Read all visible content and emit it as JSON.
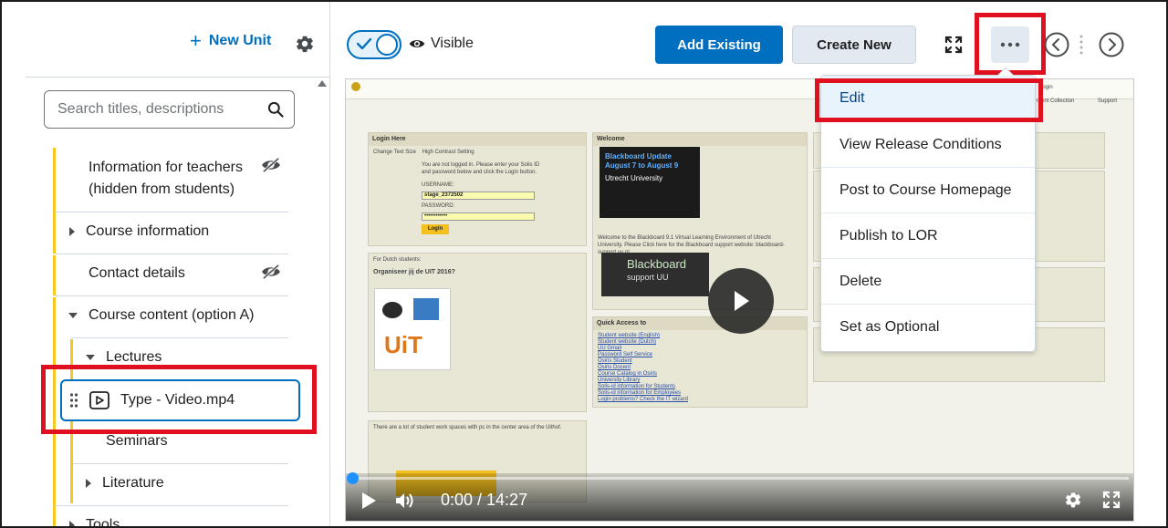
{
  "left_panel": {
    "new_unit_label": "New Unit",
    "search_placeholder": "Search titles, descriptions",
    "tree": [
      {
        "label": "Information for teachers (hidden from students)",
        "hidden": true
      },
      {
        "label": "Course information",
        "expanded": false
      },
      {
        "label": "Contact details",
        "hidden": true
      },
      {
        "label": "Course content (option A)",
        "expanded": true
      },
      {
        "label": "Lectures",
        "expanded": true
      },
      {
        "label": "Type - Video.mp4",
        "selected": true
      },
      {
        "label": "Seminars"
      },
      {
        "label": "Literature",
        "expanded": false
      },
      {
        "label": "Tools",
        "expanded": false
      }
    ]
  },
  "toolbar": {
    "visibility_label": "Visible",
    "visibility_on": true,
    "add_existing_label": "Add Existing",
    "create_new_label": "Create New"
  },
  "menu": {
    "items": [
      "Edit",
      "View Release Conditions",
      "Post to Course Homepage",
      "Publish to LOR",
      "Delete",
      "Set as Optional"
    ],
    "highlighted": "Edit"
  },
  "video": {
    "time_display": "0:00 / 14:27",
    "progress": 0.0
  },
  "preview_page": {
    "login_title": "Login Here",
    "login_link1": "Change Text Size",
    "login_link2": "High Contrast Setting",
    "login_text": "You are not logged in. Please enter your Solis ID and password below and click the Login button.",
    "username_label": "USERNAME:",
    "username_value": "stage_2372502",
    "password_label": "PASSWORD:",
    "password_value": "••••••••••••",
    "login_button": "Login",
    "welcome_title": "Welcome",
    "video_title": "Blackboard Update August 7 to August 9",
    "video_source": "Utrecht University",
    "welcome_text": "Welcome to the Blackboard 9.1 Virtual Learning Environment of Utrecht University. Please Click here for the Blackboard support website: blackboard-support.uu.nl",
    "bb_support_1": "Blackboard",
    "bb_support_2": "support UU",
    "dutch_title": "For Dutch students:",
    "uit_title": "Organiseer jij de UIT 2016?",
    "quick_access_title": "Quick Access to",
    "quick_links": [
      "Student website (English)",
      "Student website (Dutch)",
      "UU Gmail",
      "Password Self Service",
      "Osiris Student",
      "Osiris Docent",
      "Course Catalog in Osiris",
      "University Library",
      "Solis-id information for Students",
      "Solis-id information for Employees",
      "Login problems? Check the IT wizard"
    ],
    "work_text": "There are a lot of student work spaces with pc in the center area of the Uithof.",
    "top_right_1": "ntent Collection",
    "top_right_2": "Support",
    "login_top": "Login"
  },
  "colors": {
    "accent": "#006fbf",
    "highlight_red": "#e01020",
    "tree_bar": "#f6c823"
  }
}
